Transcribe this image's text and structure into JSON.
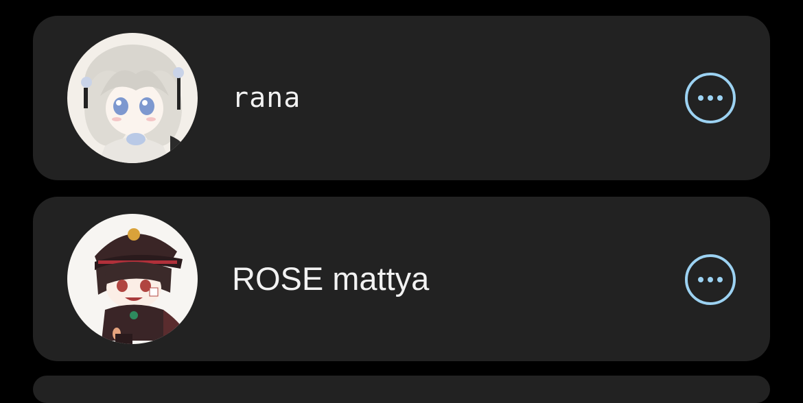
{
  "contacts": [
    {
      "name": "rana",
      "avatar_icon": "anime-avatar-icon",
      "more_icon": "more-options-icon"
    },
    {
      "name": "ROSE  mattya",
      "avatar_icon": "anime-avatar-icon",
      "more_icon": "more-options-icon"
    }
  ],
  "colors": {
    "background": "#000000",
    "card": "#222222",
    "accent": "#9cd2f2",
    "text": "#f2f2f2"
  }
}
